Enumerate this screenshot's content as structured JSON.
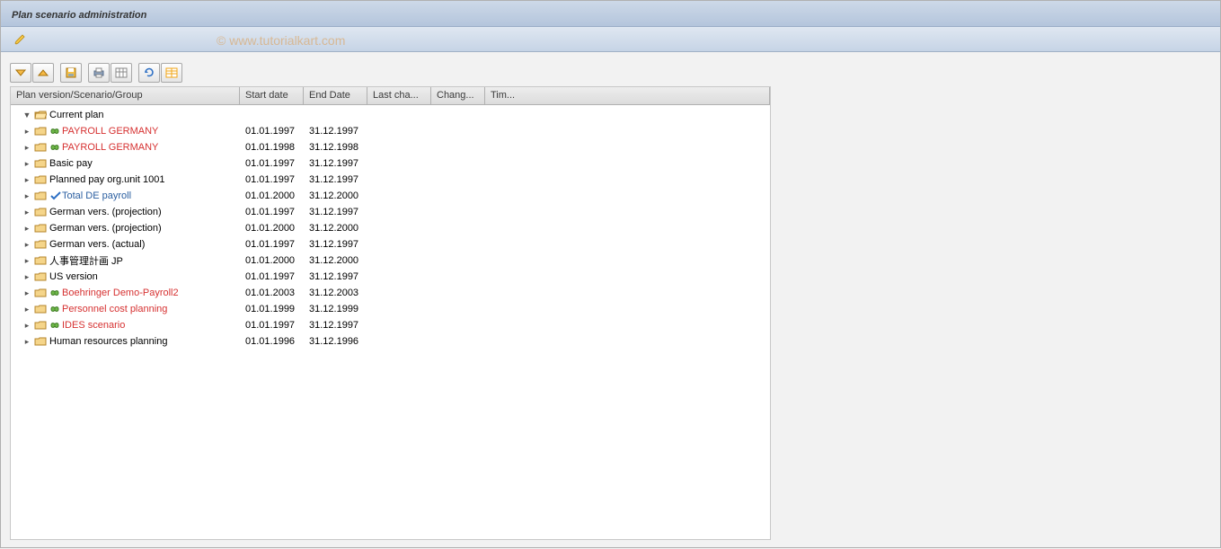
{
  "title": "Plan scenario administration",
  "watermark": "© www.tutorialkart.com",
  "toolbar": {
    "edit_icon": "pencil-icon"
  },
  "tree_toolbar": {
    "icons": [
      "expand-all-icon",
      "collapse-all-icon",
      "sep",
      "save-icon",
      "sep",
      "print-icon",
      "layout-icon",
      "sep",
      "refresh-icon",
      "spreadsheet-icon"
    ]
  },
  "columns": {
    "c0": "Plan version/Scenario/Group",
    "c1": "Start date",
    "c2": "End Date",
    "c3": "Last cha...",
    "c4": "Chang...",
    "c5": "Tim..."
  },
  "root": {
    "label": "Current plan"
  },
  "rows": [
    {
      "label": "PAYROLL GERMANY",
      "start": "01.01.1997",
      "end": "31.12.1997",
      "color": "red",
      "badge": "link-icon"
    },
    {
      "label": "PAYROLL GERMANY",
      "start": "01.01.1998",
      "end": "31.12.1998",
      "color": "red",
      "badge": "link-icon"
    },
    {
      "label": "Basic pay",
      "start": "01.01.1997",
      "end": "31.12.1997",
      "color": "black",
      "badge": ""
    },
    {
      "label": "Planned pay org.unit 1001",
      "start": "01.01.1997",
      "end": "31.12.1997",
      "color": "black",
      "badge": ""
    },
    {
      "label": "Total DE payroll",
      "start": "01.01.2000",
      "end": "31.12.2000",
      "color": "blue",
      "badge": "check-icon"
    },
    {
      "label": "German vers. (projection)",
      "start": "01.01.1997",
      "end": "31.12.1997",
      "color": "black",
      "badge": ""
    },
    {
      "label": "German vers. (projection)",
      "start": "01.01.2000",
      "end": "31.12.2000",
      "color": "black",
      "badge": ""
    },
    {
      "label": "German vers. (actual)",
      "start": "01.01.1997",
      "end": "31.12.1997",
      "color": "black",
      "badge": ""
    },
    {
      "label": "人事管理計画 JP",
      "start": "01.01.2000",
      "end": "31.12.2000",
      "color": "black",
      "badge": ""
    },
    {
      "label": "US version",
      "start": "01.01.1997",
      "end": "31.12.1997",
      "color": "black",
      "badge": ""
    },
    {
      "label": "Boehringer Demo-Payroll2",
      "start": "01.01.2003",
      "end": "31.12.2003",
      "color": "red",
      "badge": "link-icon"
    },
    {
      "label": "Personnel cost planning",
      "start": "01.01.1999",
      "end": "31.12.1999",
      "color": "red",
      "badge": "link-icon"
    },
    {
      "label": "IDES scenario",
      "start": "01.01.1997",
      "end": "31.12.1997",
      "color": "red",
      "badge": "link-icon"
    },
    {
      "label": "Human resources planning",
      "start": "01.01.1996",
      "end": "31.12.1996",
      "color": "black",
      "badge": ""
    }
  ]
}
